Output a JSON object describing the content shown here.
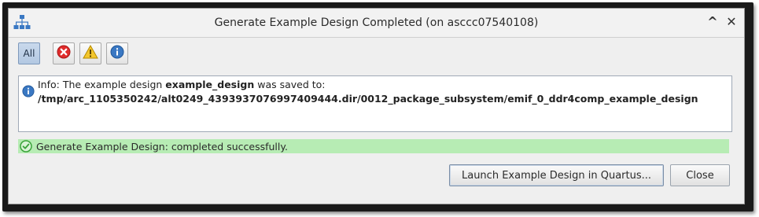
{
  "window": {
    "title": "Generate Example Design Completed (on asccc07540108)",
    "app_icon": "network-hierarchy-icon",
    "controls": {
      "collapse_glyph": "^",
      "close_glyph": "✕"
    }
  },
  "filters": {
    "all_label": "All",
    "error_icon": "error-icon",
    "warning_icon": "warning-icon",
    "info_icon": "info-icon",
    "selected": "All"
  },
  "log": {
    "entries": [
      {
        "level": "info",
        "prefix": "Info: The example design ",
        "design_name": "example_design",
        "suffix": " was saved to:",
        "path": "/tmp/arc_1105350242/alt0249_4393937076997409444.dir/0012_package_subsystem/emif_0_ddr4comp_example_design"
      }
    ]
  },
  "status": {
    "text": "Generate Example Design: completed successfully.",
    "color": "#b7ecb4"
  },
  "buttons": {
    "launch_label": "Launch Example Design in Quartus...",
    "close_label": "Close"
  },
  "colors": {
    "accent": "#3a78c3",
    "error": "#e02b2b",
    "warning": "#f3c62c",
    "success": "#3aa33a"
  }
}
